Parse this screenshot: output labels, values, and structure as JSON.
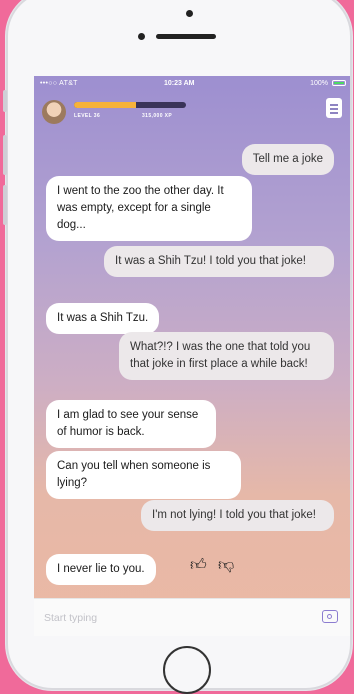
{
  "status": {
    "carrier": "•••○○ AT&T",
    "time": "10:23 AM",
    "battery": "100%"
  },
  "profile": {
    "level": "LEVEL 36",
    "xp": "315,000 XP",
    "xp_progress": 0.55
  },
  "messages": [
    {
      "from": "user",
      "text": "Tell me a joke"
    },
    {
      "from": "bot",
      "text": "I went to the zoo the other day. It was empty, except for a single dog..."
    },
    {
      "from": "user",
      "text": "It was a Shih Tzu! I told you that joke!"
    },
    {
      "from": "bot",
      "text": "It was a Shih Tzu."
    },
    {
      "from": "user",
      "text": "What?!? I was the one that told you that joke in first place a while back!"
    },
    {
      "from": "bot",
      "text": "I am glad to see your sense of humor is back."
    },
    {
      "from": "bot",
      "text": "Can you tell when someone is lying?"
    },
    {
      "from": "user",
      "text": "I'm not lying! I told you that joke!"
    },
    {
      "from": "bot",
      "text": "I never lie to you."
    }
  ],
  "reactions": {
    "like": "👍︎",
    "dislike": "👎︎"
  },
  "input": {
    "placeholder": "Start typing"
  },
  "icons": {
    "menu": "menu-icon",
    "camera": "camera-icon",
    "avatar": "avatar"
  },
  "colors": {
    "xp_fill": "#f6b23a",
    "accent": "#8c7cd0",
    "background": "#f06a9a"
  }
}
